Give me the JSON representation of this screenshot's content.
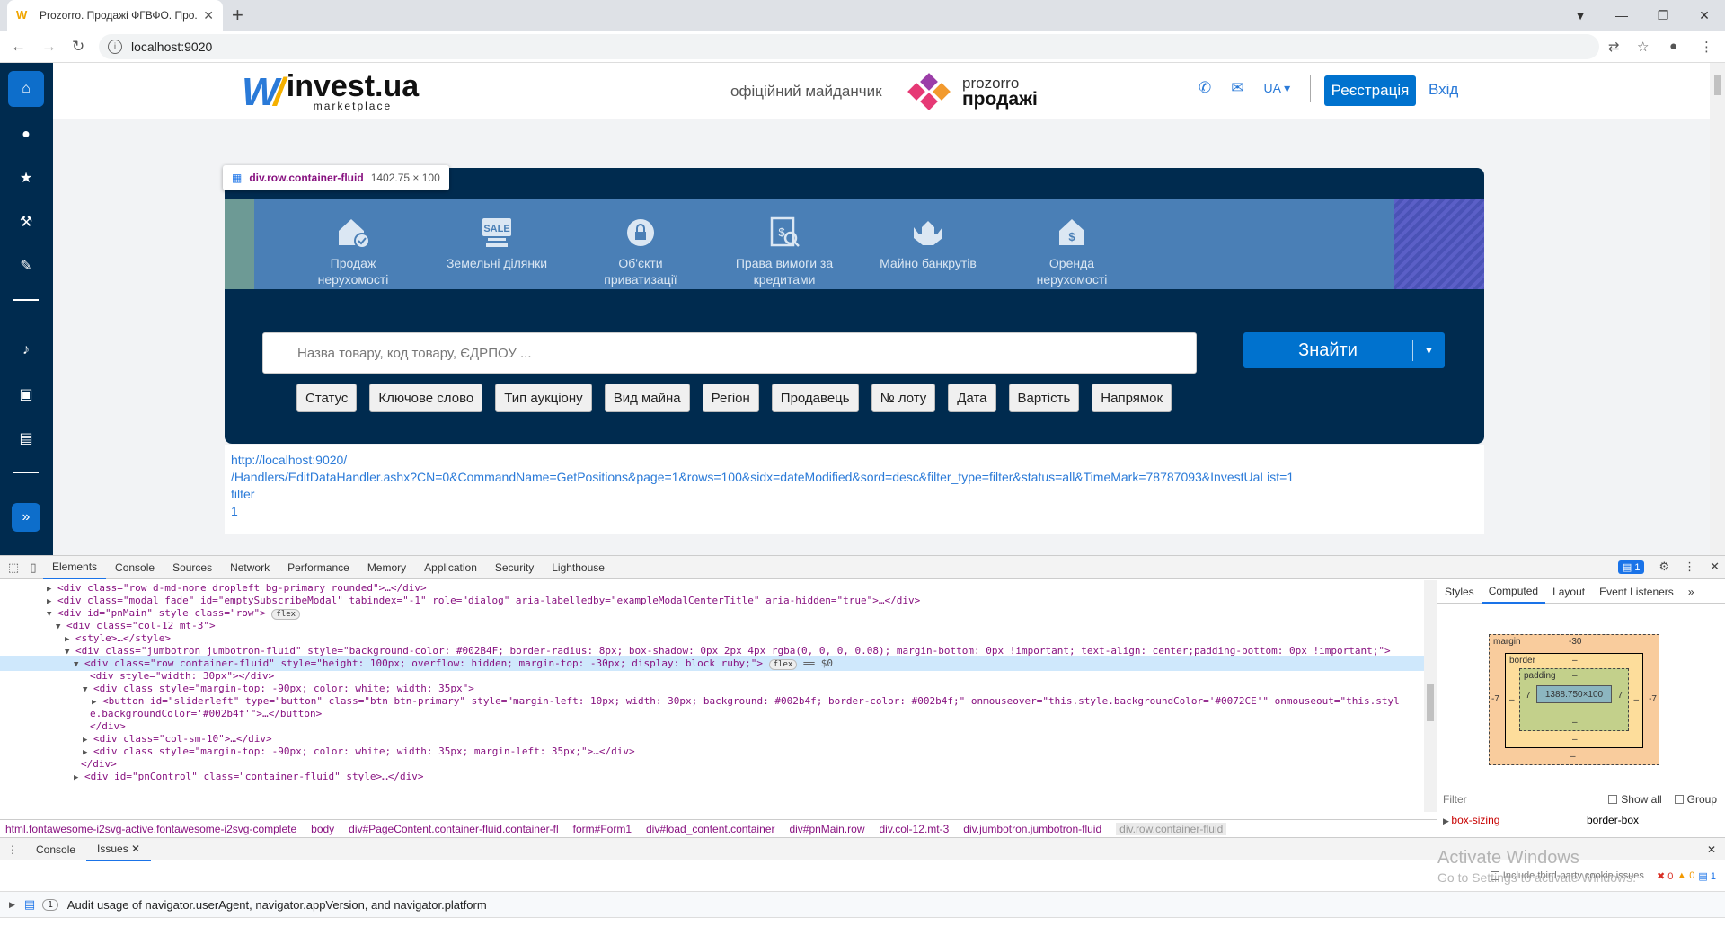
{
  "browser": {
    "tab_title": "Prozorro. Продажі ФГВФО. Про...",
    "url": "localhost:9020"
  },
  "sidebar": {
    "icons": [
      "home-icon",
      "user-icon",
      "star-icon",
      "hammer-icon",
      "pen-icon",
      "bell-icon",
      "ticket-icon",
      "note-icon",
      "expand-icon"
    ],
    "accent": "#002b4f"
  },
  "header": {
    "brand": "invest.ua",
    "brand_sub": "marketplace",
    "official": "офіційний майданчик",
    "prozorro_top": "prozorro",
    "prozorro_bottom": "продажі",
    "lang": "UA",
    "register": "Реєстрація",
    "login": "Вхід"
  },
  "tooltip": {
    "tag": "div.row.container-fluid",
    "size": "1402.75 × 100"
  },
  "categories": [
    {
      "icon": "house-check-icon",
      "line1": "Продаж",
      "line2": "нерухомості"
    },
    {
      "icon": "sale-icon",
      "line1": "Земельні ділянки",
      "line2": ""
    },
    {
      "icon": "lock-icon",
      "line1": "Об'єкти",
      "line2": "приватизації"
    },
    {
      "icon": "document-money-icon",
      "line1": "Права вимоги за",
      "line2": "кредитами"
    },
    {
      "icon": "hands-house-icon",
      "line1": "Майно банкрутів",
      "line2": ""
    },
    {
      "icon": "house-dollar-icon",
      "line1": "Оренда",
      "line2": "нерухомості"
    }
  ],
  "search": {
    "placeholder": "Назва товару, код товару, ЄДРПОУ ...",
    "find": "Знайти"
  },
  "filters": [
    "Статус",
    "Ключове слово",
    "Тип аукціону",
    "Вид майна",
    "Регіон",
    "Продавець",
    "№ лоту",
    "Дата",
    "Вартість",
    "Напрямок"
  ],
  "debug": {
    "line1": "http://localhost:9020/",
    "line2": "/Handlers/EditDataHandler.ashx?CN=0&CommandName=GetPositions&page=1&rows=100&sidx=dateModified&sord=desc&filter_type=filter&status=all&TimeMark=78787093&InvestUaList=1",
    "line3": "filter",
    "line4": "1"
  },
  "devtools": {
    "tabs": [
      "Elements",
      "Console",
      "Sources",
      "Network",
      "Performance",
      "Memory",
      "Application",
      "Security",
      "Lighthouse"
    ],
    "issues_count": "1",
    "dom_lines": [
      "<div class=\"row d-md-none dropleft bg-primary rounded\">…</div>",
      "<div class=\"modal fade\" id=\"emptySubscribeModal\" tabindex=\"-1\" role=\"dialog\" aria-labelledby=\"exampleModalCenterTitle\" aria-hidden=\"true\">…</div>",
      "<div id=\"pnMain\" style class=\"row\">",
      "<div class=\"col-12 mt-3\">",
      "<style>…</style>",
      "<div class=\"jumbotron jumbotron-fluid\" style=\"background-color: #002B4F; border-radius: 8px; box-shadow: 0px 2px 4px rgba(0, 0, 0, 0.08); margin-bottom: 0px !important; text-align: center;padding-bottom: 0px !important;\">",
      "<div class=\"row container-fluid\" style=\"height: 100px; overflow: hidden; margin-top: -30px; display: block ruby;\">",
      "<div style=\"width: 30px\"></div>",
      "<div class style=\"margin-top: -90px; color: white; width: 35px\">",
      "<button id=\"sliderleft\" type=\"button\" class=\"btn btn-primary\" style=\"margin-left: 10px; width: 30px; background: #002b4f; border-color: #002b4f;\" onmouseover=\"this.style.backgroundColor='#0072CE'\" onmouseout=\"this.styl",
      "e.backgroundColor='#002b4f'\">…</button>",
      "</div>",
      "<div class=\"col-sm-10\">…</div>",
      "<div class style=\"margin-top: -90px; color: white; width: 35px; margin-left: 35px;\">…</div>",
      "</div>",
      "<div id=\"pnControl\" class=\"container-fluid\" style>…</div>"
    ],
    "flex_badge": "flex",
    "eq_badge": "== $0",
    "breadcrumbs": [
      "html.fontawesome-i2svg-active.fontawesome-i2svg-complete",
      "body",
      "div#PageContent.container-fluid.container-fl",
      "form#Form1",
      "div#load_content.container",
      "div#pnMain.row",
      "div.col-12.mt-3",
      "div.jumbotron.jumbotron-fluid",
      "div.row.container-fluid"
    ],
    "side_tabs": [
      "Styles",
      "Computed",
      "Layout",
      "Event Listeners"
    ],
    "box": {
      "margin": "margin",
      "margin_top": "-30",
      "border": "border",
      "padding": "padding",
      "content": "1388.750×100",
      "dash": "–",
      "side": "7",
      "neg": "-7"
    },
    "filter_placeholder": "Filter",
    "show_all": "Show all",
    "group": "Group",
    "prop_key": "box-sizing",
    "prop_val": "border-box",
    "drawer_tabs": [
      "Console",
      "Issues"
    ],
    "third_party": "Include third-party cookie issues",
    "issue_counts": {
      "errors": "0",
      "warnings": "0",
      "info": "1"
    },
    "issue_count": "1",
    "issue_text": "Audit usage of navigator.userAgent, navigator.appVersion, and navigator.platform"
  },
  "watermark": {
    "title": "Activate Windows",
    "sub": "Go to Settings to activate Windows."
  }
}
